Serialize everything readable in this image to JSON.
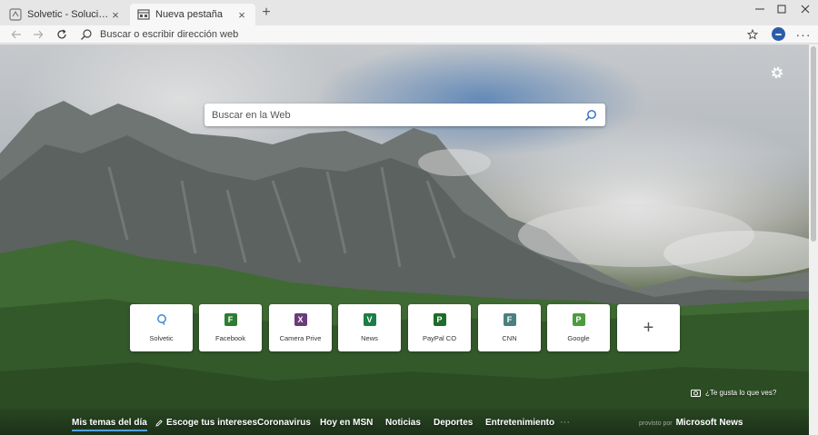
{
  "tabs": [
    {
      "title": "Solvetic - Solución a los problemas informáticos",
      "active": false,
      "icon": "solvetic-icon"
    },
    {
      "title": "Nueva pestaña",
      "active": true,
      "icon": "new-tab-icon"
    }
  ],
  "address_bar": {
    "placeholder": "Buscar o escribir dirección web"
  },
  "search": {
    "placeholder": "Buscar en la Web"
  },
  "quick_links": [
    {
      "label": "Solvetic",
      "letter": "",
      "color": "#4a8fd8",
      "icon": "solvetic-logo-icon"
    },
    {
      "label": "Facebook",
      "letter": "F",
      "color": "#2e7d32"
    },
    {
      "label": "Camera Prive",
      "letter": "X",
      "color": "#6a3d7a"
    },
    {
      "label": "News",
      "letter": "V",
      "color": "#1b7e46"
    },
    {
      "label": "PayPal CO",
      "letter": "P",
      "color": "#1e6b2a"
    },
    {
      "label": "CNN",
      "letter": "F",
      "color": "#4c7f7f"
    },
    {
      "label": "Google",
      "letter": "P",
      "color": "#4e9a3f"
    }
  ],
  "feedback": {
    "text": "¿Te gusta lo que ves?"
  },
  "news_nav": {
    "items": [
      {
        "label": "Mis temas del día",
        "active": true
      },
      {
        "label": "Escoge tus intereses",
        "active": false,
        "icon": "pencil-icon"
      },
      {
        "label": "Coronavirus",
        "active": false
      },
      {
        "label": "Hoy en MSN",
        "active": false
      },
      {
        "label": "Noticias",
        "active": false
      },
      {
        "label": "Deportes",
        "active": false
      },
      {
        "label": "Entretenimiento",
        "active": false
      }
    ],
    "more": "···",
    "powered_by": "provisto por",
    "brand": "Microsoft News"
  },
  "colors": {
    "accent": "#4ea1f5",
    "avatar": "#2b5ca8"
  }
}
